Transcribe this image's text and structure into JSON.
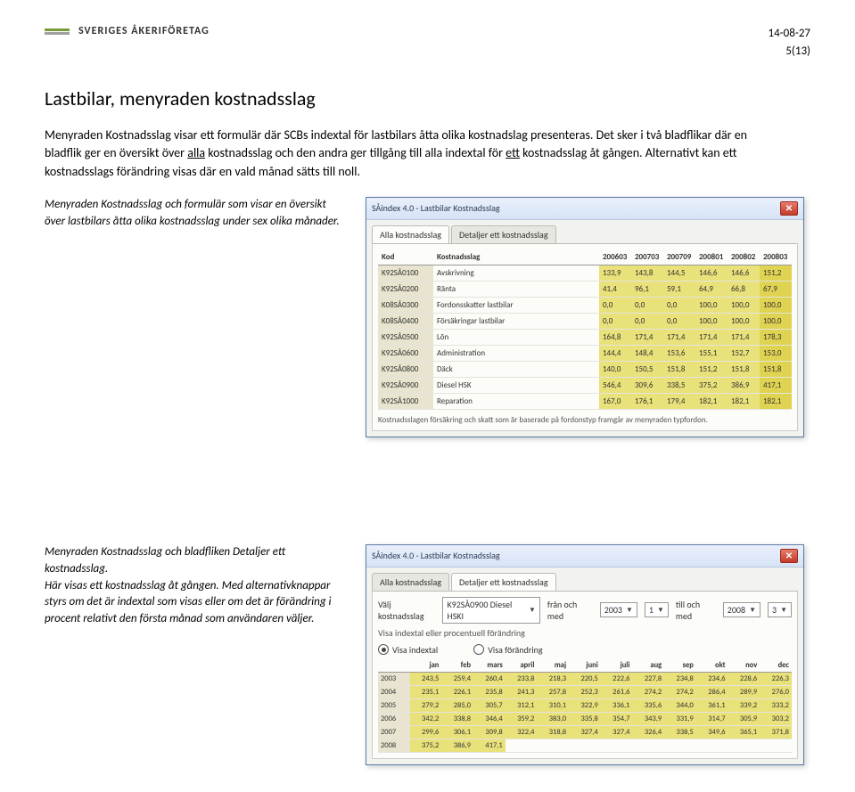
{
  "header": {
    "logo_text": "SVERIGES ÅKERIFÖRETAG",
    "date": "14-08-27",
    "page": "5(13)"
  },
  "article": {
    "heading": "Lastbilar, menyraden kostnadsslag",
    "p1a": "Menyraden Kostnadsslag visar ett formulär där SCBs indextal för lastbilars åtta olika kostnadslag presenteras. ",
    "p1b": "Det sker i två bladflikar där en bladflik ger en översikt över ",
    "p1c_u": "alla",
    "p1d": " kostnadsslag och den andra ger tillgång till alla indextal för ",
    "p1e_u": "ett",
    "p1f": " kostnadsslag åt gången. Alternativt kan ett kostnadsslags förändring visas där en vald månad sätts till noll.",
    "caption1": "Menyraden Kostnadsslag och formulär som visar en översikt över lastbilars åtta olika kostnadsslag under sex olika månader.",
    "caption2a": "Menyraden Kostnadsslag och bladfliken Detaljer ett kostnadsslag.",
    "caption2b": "Här visas ett kostnadsslag åt gången. Med alternativknappar styrs om det är indextal som visas eller om det är förändring i procent relativt den första månad som användaren väljer."
  },
  "win1": {
    "title": "SÅindex 4.0 - Lastbilar Kostnadsslag",
    "tab1": "Alla kostnadsslag",
    "tab2": "Detaljer ett kostnadsslag",
    "cols": {
      "kod": "Kod",
      "slag": "Kostnadsslag",
      "c1": "200603",
      "c2": "200703",
      "c3": "200709",
      "c4": "200801",
      "c5": "200802",
      "c6": "200803"
    },
    "rows": [
      {
        "kod": "K92SÅ0100",
        "slag": "Avskrivning",
        "v": [
          "133,9",
          "143,8",
          "144,5",
          "146,6",
          "146,6",
          "151,2"
        ]
      },
      {
        "kod": "K92SÅ0200",
        "slag": "Ränta",
        "v": [
          "41,4",
          "96,1",
          "59,1",
          "64,9",
          "66,8",
          "67,9"
        ]
      },
      {
        "kod": "K08SÅ0300",
        "slag": "Fordonsskatter lastbilar",
        "v": [
          "0,0",
          "0,0",
          "0,0",
          "100,0",
          "100,0",
          "100,0"
        ]
      },
      {
        "kod": "K08SÅ0400",
        "slag": "Försäkringar lastbilar",
        "v": [
          "0,0",
          "0,0",
          "0,0",
          "100,0",
          "100,0",
          "100,0"
        ]
      },
      {
        "kod": "K92SÅ0500",
        "slag": "Lön",
        "v": [
          "164,8",
          "171,4",
          "171,4",
          "171,4",
          "171,4",
          "178,3"
        ]
      },
      {
        "kod": "K92SÅ0600",
        "slag": "Administration",
        "v": [
          "144,4",
          "148,4",
          "153,6",
          "155,1",
          "152,7",
          "153,0"
        ]
      },
      {
        "kod": "K92SÅ0800",
        "slag": "Däck",
        "v": [
          "140,0",
          "150,5",
          "151,8",
          "151,2",
          "151,8",
          "151,8"
        ]
      },
      {
        "kod": "K92SÅ0900",
        "slag": "Diesel HSK",
        "v": [
          "546,4",
          "309,6",
          "338,5",
          "375,2",
          "386,9",
          "417,1"
        ]
      },
      {
        "kod": "K92SÅ1000",
        "slag": "Reparation",
        "v": [
          "167,0",
          "176,1",
          "179,4",
          "182,1",
          "182,1",
          "182,1"
        ]
      }
    ],
    "footnote": "Kostnadsslagen försäkring och skatt som är baserade på fordonstyp framgår av menyraden typfordon."
  },
  "win2": {
    "title": "SÅindex 4.0 - Lastbilar Kostnadsslag",
    "tab1": "Alla kostnadsslag",
    "tab2": "Detaljer ett kostnadsslag",
    "label_select": "Välj kostnadsslag",
    "select_value": "K92SÅ0900 Diesel HSKI",
    "label_from": "från och med",
    "from_year": "2003",
    "from_month": "1",
    "label_to": "till och med",
    "to_year": "2008",
    "to_month": "3",
    "label_line2": "Visa indextal eller procentuell förändring",
    "radio1": "Visa indextal",
    "radio2": "Visa förändring",
    "months": [
      "jan",
      "feb",
      "mars",
      "april",
      "maj",
      "juni",
      "juli",
      "aug",
      "sep",
      "okt",
      "nov",
      "dec"
    ],
    "years": [
      {
        "y": "2003",
        "v": [
          "243,5",
          "259,4",
          "260,4",
          "233,8",
          "218,3",
          "220,5",
          "222,6",
          "227,8",
          "234,8",
          "234,6",
          "228,6",
          "226,3"
        ]
      },
      {
        "y": "2004",
        "v": [
          "235,1",
          "226,1",
          "235,8",
          "241,3",
          "257,8",
          "252,3",
          "261,6",
          "274,2",
          "274,2",
          "286,4",
          "289,9",
          "276,0"
        ]
      },
      {
        "y": "2005",
        "v": [
          "279,2",
          "285,0",
          "305,7",
          "312,1",
          "310,1",
          "322,9",
          "336,1",
          "335,6",
          "344,0",
          "361,1",
          "339,2",
          "333,2"
        ]
      },
      {
        "y": "2006",
        "v": [
          "342,2",
          "338,8",
          "346,4",
          "359,2",
          "383,0",
          "335,8",
          "354,7",
          "343,9",
          "331,9",
          "314,7",
          "305,9",
          "303,2"
        ]
      },
      {
        "y": "2007",
        "v": [
          "299,6",
          "306,1",
          "309,8",
          "322,4",
          "318,8",
          "327,4",
          "327,4",
          "326,4",
          "338,5",
          "349,6",
          "365,1",
          "371,8"
        ]
      },
      {
        "y": "2008",
        "v": [
          "375,2",
          "386,9",
          "417,1",
          "",
          "",
          "",
          "",
          "",
          "",
          "",
          "",
          ""
        ]
      }
    ]
  }
}
